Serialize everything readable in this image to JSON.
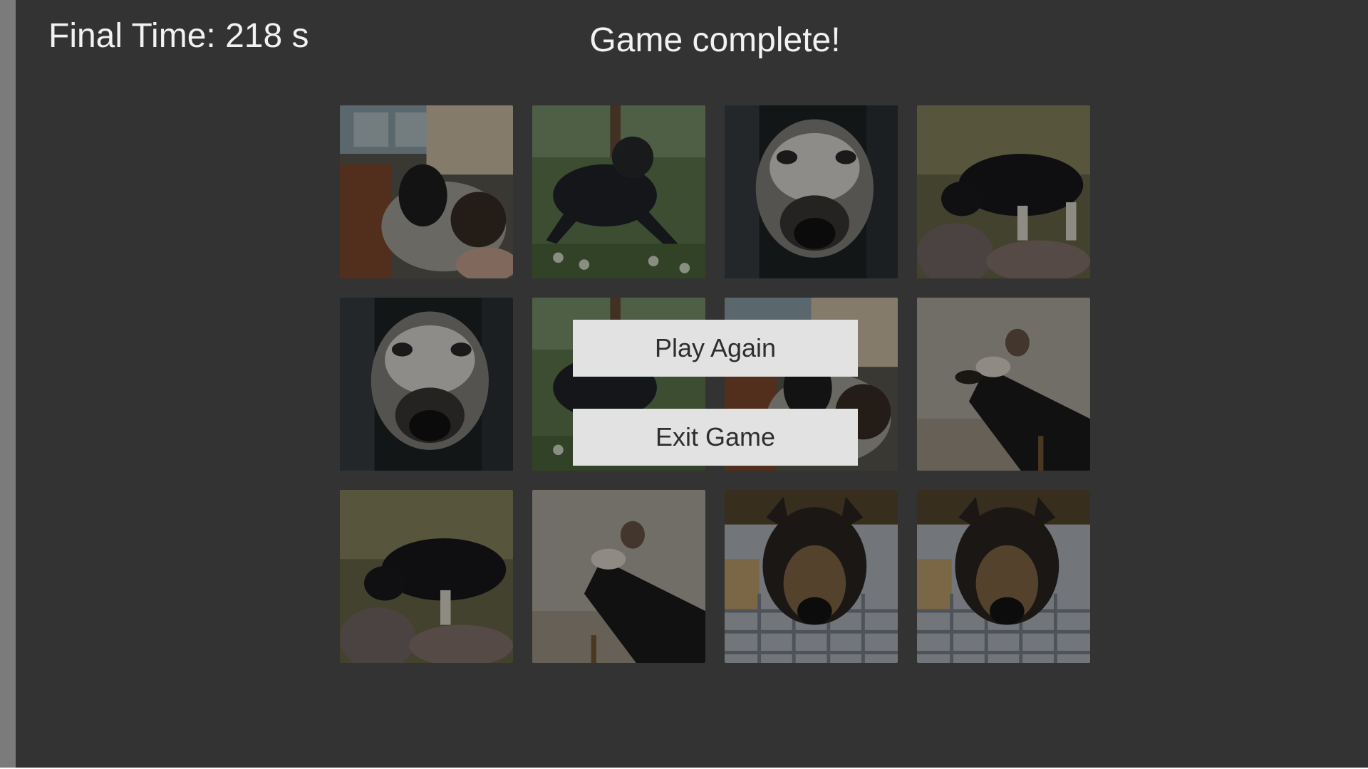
{
  "game": {
    "final_time": "Final Time: 218 s",
    "status": "Game complete!"
  },
  "buttons": {
    "play_again": "Play Again",
    "exit_game": "Exit Game"
  },
  "board": {
    "rows": 3,
    "columns": 4,
    "cards": [
      "dog-in-car-icon",
      "dog-in-rain-icon",
      "husky-closeup-icon",
      "dog-on-rocks-icon",
      "husky-closeup-icon",
      "dog-in-rain-icon",
      "dog-in-car-icon",
      "dog-paws-icon",
      "dog-on-rocks-icon",
      "dog-paws-icon",
      "shepherd-on-blanket-icon",
      "shepherd-on-blanket-icon"
    ]
  },
  "colors": {
    "background": "#333333",
    "left_strip": "#7b7b7b",
    "button_bg": "#e2e2e2",
    "button_text": "#2e2e2e",
    "heading_text": "#f2f2f2"
  }
}
